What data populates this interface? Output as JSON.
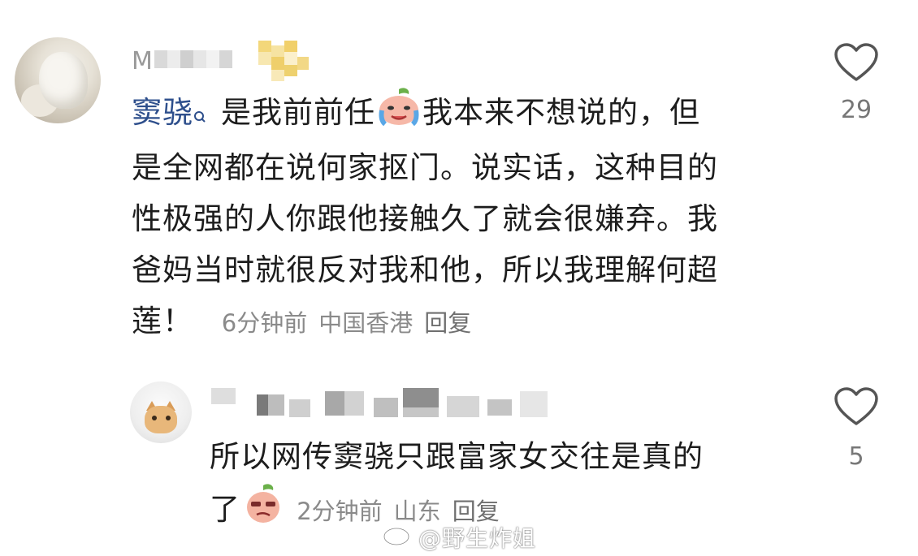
{
  "comments": [
    {
      "username": "M",
      "mention": "窦骁",
      "text_lines": [
        "是我前前任",
        "我本来不想说的，但",
        "是全网都在说何家抠门。说实话，这种目的",
        "性极强的人你跟他接触久了就会很嫌弃。我",
        "爸妈当时就很反对我和他，所以我理解何超",
        "莲！"
      ],
      "time": "6分钟前",
      "location": "中国香港",
      "reply_label": "回复",
      "likes": "29"
    },
    {
      "text_lines": [
        "所以网传窦骁只跟富家女交往是真的",
        "了"
      ],
      "time": "2分钟前",
      "location": "山东",
      "reply_label": "回复",
      "likes": "5"
    }
  ],
  "icons": {
    "heart": "heart-outline-icon",
    "search_mark": "search-icon",
    "crying_emoji": "crying-peach-emoji",
    "smug_emoji": "smug-peach-emoji",
    "weibo": "weibo-logo-icon"
  },
  "watermark": "@野生炸姐",
  "colors": {
    "mention": "#2e4f8c",
    "meta": "#8a8a8a",
    "heart": "#555555"
  }
}
